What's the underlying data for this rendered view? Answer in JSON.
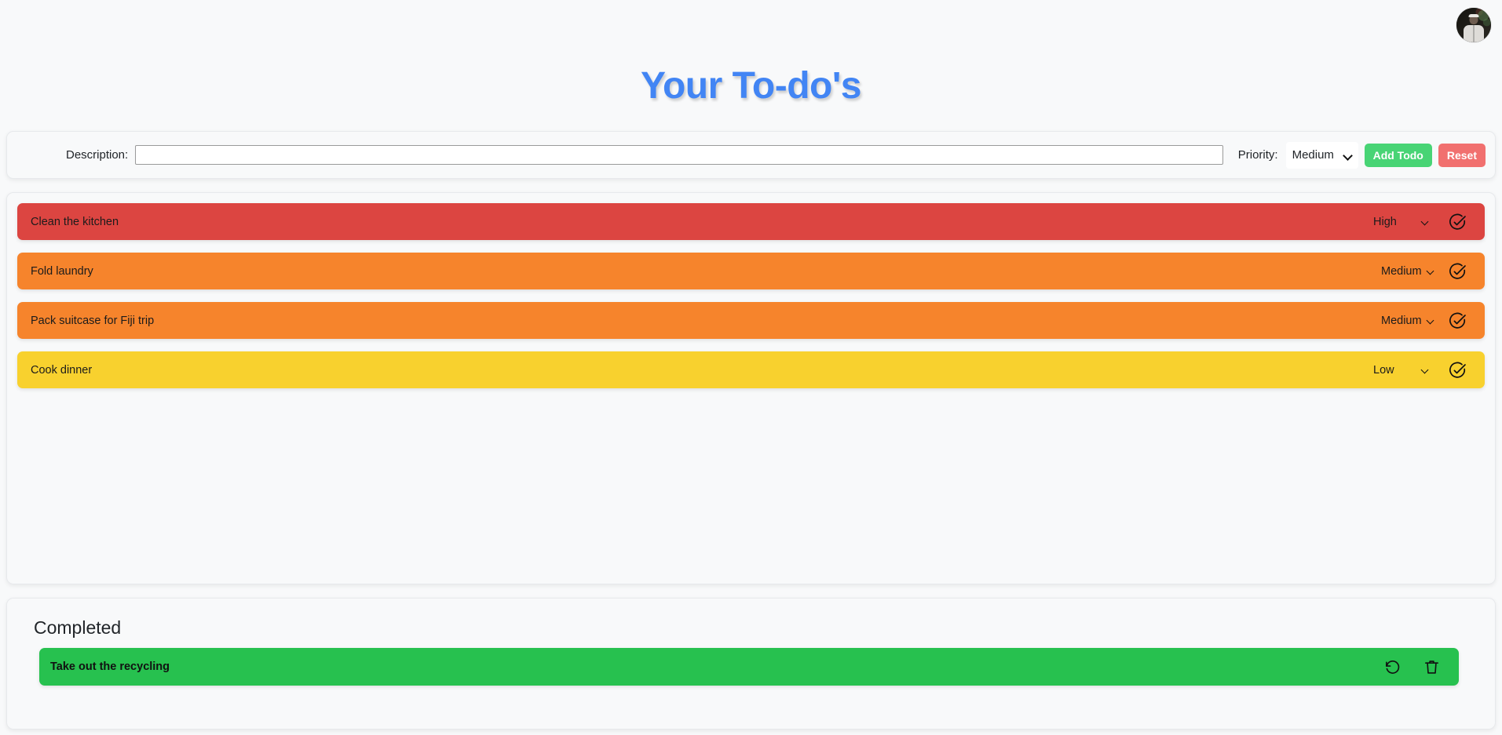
{
  "header": {
    "title": "Your To-do's",
    "title_color": "#4285f4",
    "avatar_alt": "user-avatar"
  },
  "form": {
    "description_label": "Description:",
    "description_value": "",
    "description_placeholder": "",
    "priority_label": "Priority:",
    "priority_selected": "Medium",
    "priority_options": [
      "High",
      "Medium",
      "Low"
    ],
    "add_label": "Add Todo",
    "reset_label": "Reset",
    "add_color": "#48d475",
    "reset_color": "#f1706f"
  },
  "todos": [
    {
      "text": "Clean the kitchen",
      "priority": "High",
      "color": "#dc4541",
      "complete_icon": "check-circle-icon"
    },
    {
      "text": "Fold laundry",
      "priority": "Medium",
      "color": "#f6842c",
      "complete_icon": "check-circle-icon"
    },
    {
      "text": "Pack suitcase for Fiji trip",
      "priority": "Medium",
      "color": "#f6842c",
      "complete_icon": "check-circle-icon"
    },
    {
      "text": "Cook dinner",
      "priority": "Low",
      "color": "#f8d12e",
      "complete_icon": "check-circle-icon"
    }
  ],
  "completed": {
    "heading": "Completed",
    "items": [
      {
        "text": "Take out the recycling",
        "color": "#27c14f",
        "restore_icon": "undo-icon",
        "delete_icon": "trash-icon"
      }
    ]
  }
}
